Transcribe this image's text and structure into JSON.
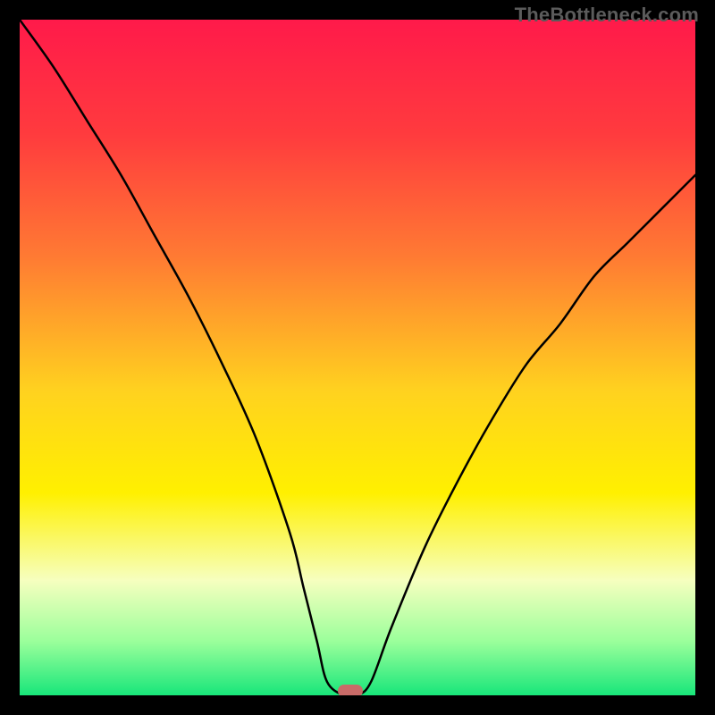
{
  "watermark": "TheBottleneck.com",
  "chart_data": {
    "type": "line",
    "title": "",
    "xlabel": "",
    "ylabel": "",
    "xlim": [
      0,
      100
    ],
    "ylim": [
      0,
      100
    ],
    "gradient_stops": [
      {
        "offset": 0,
        "color": "#ff1a4a"
      },
      {
        "offset": 17,
        "color": "#ff3b3e"
      },
      {
        "offset": 35,
        "color": "#ff7a33"
      },
      {
        "offset": 55,
        "color": "#ffd21f"
      },
      {
        "offset": 70,
        "color": "#fff000"
      },
      {
        "offset": 83,
        "color": "#f6ffbf"
      },
      {
        "offset": 92,
        "color": "#9bff9b"
      },
      {
        "offset": 100,
        "color": "#18e67a"
      }
    ],
    "series": [
      {
        "name": "bottleneck-curve",
        "x": [
          0,
          5,
          10,
          15,
          20,
          25,
          30,
          35,
          40,
          42,
          44,
          45.5,
          48,
          50,
          52,
          55,
          60,
          65,
          70,
          75,
          80,
          85,
          90,
          95,
          100
        ],
        "y": [
          100,
          93,
          85,
          77,
          68,
          59,
          49,
          38,
          24,
          16,
          8,
          2,
          0,
          0,
          2,
          10,
          22,
          32,
          41,
          49,
          55,
          62,
          67,
          72,
          77
        ]
      }
    ],
    "marker": {
      "x": 49,
      "y": 0.7,
      "color": "#c96b68"
    }
  }
}
